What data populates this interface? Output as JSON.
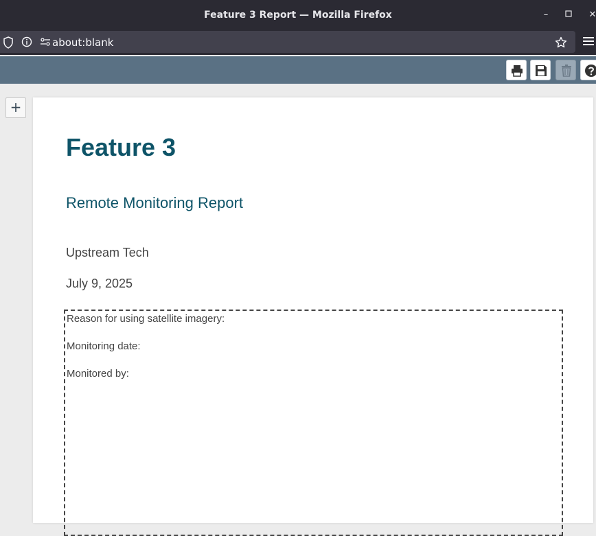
{
  "window": {
    "title": "Feature 3 Report — Mozilla Firefox",
    "minimize": "–",
    "maximize": "▢",
    "close": "✕"
  },
  "browser": {
    "url": "about:blank",
    "icons": [
      "shield-icon",
      "info-icon",
      "permissions-icon",
      "bookmark-star-icon",
      "hamburger-menu-icon"
    ]
  },
  "toolbar": {
    "buttons": [
      {
        "name": "print",
        "icon": "printer-icon",
        "enabled": true
      },
      {
        "name": "save",
        "icon": "floppy-disk-icon",
        "enabled": true
      },
      {
        "name": "delete",
        "icon": "trash-icon",
        "enabled": false
      },
      {
        "name": "help",
        "icon": "question-circle-icon",
        "enabled": true
      }
    ],
    "bar_color": "#5a7184"
  },
  "sidebar": {
    "add_label": "+"
  },
  "report": {
    "title": "Feature 3",
    "subtitle": "Remote Monitoring Report",
    "organization": "Upstream Tech",
    "date": "July 9, 2025",
    "fields": [
      {
        "label": "Reason for using satellite imagery:"
      },
      {
        "label": "Monitoring date:"
      },
      {
        "label": "Monitored by:"
      }
    ],
    "accent_color": "#0e5468"
  }
}
